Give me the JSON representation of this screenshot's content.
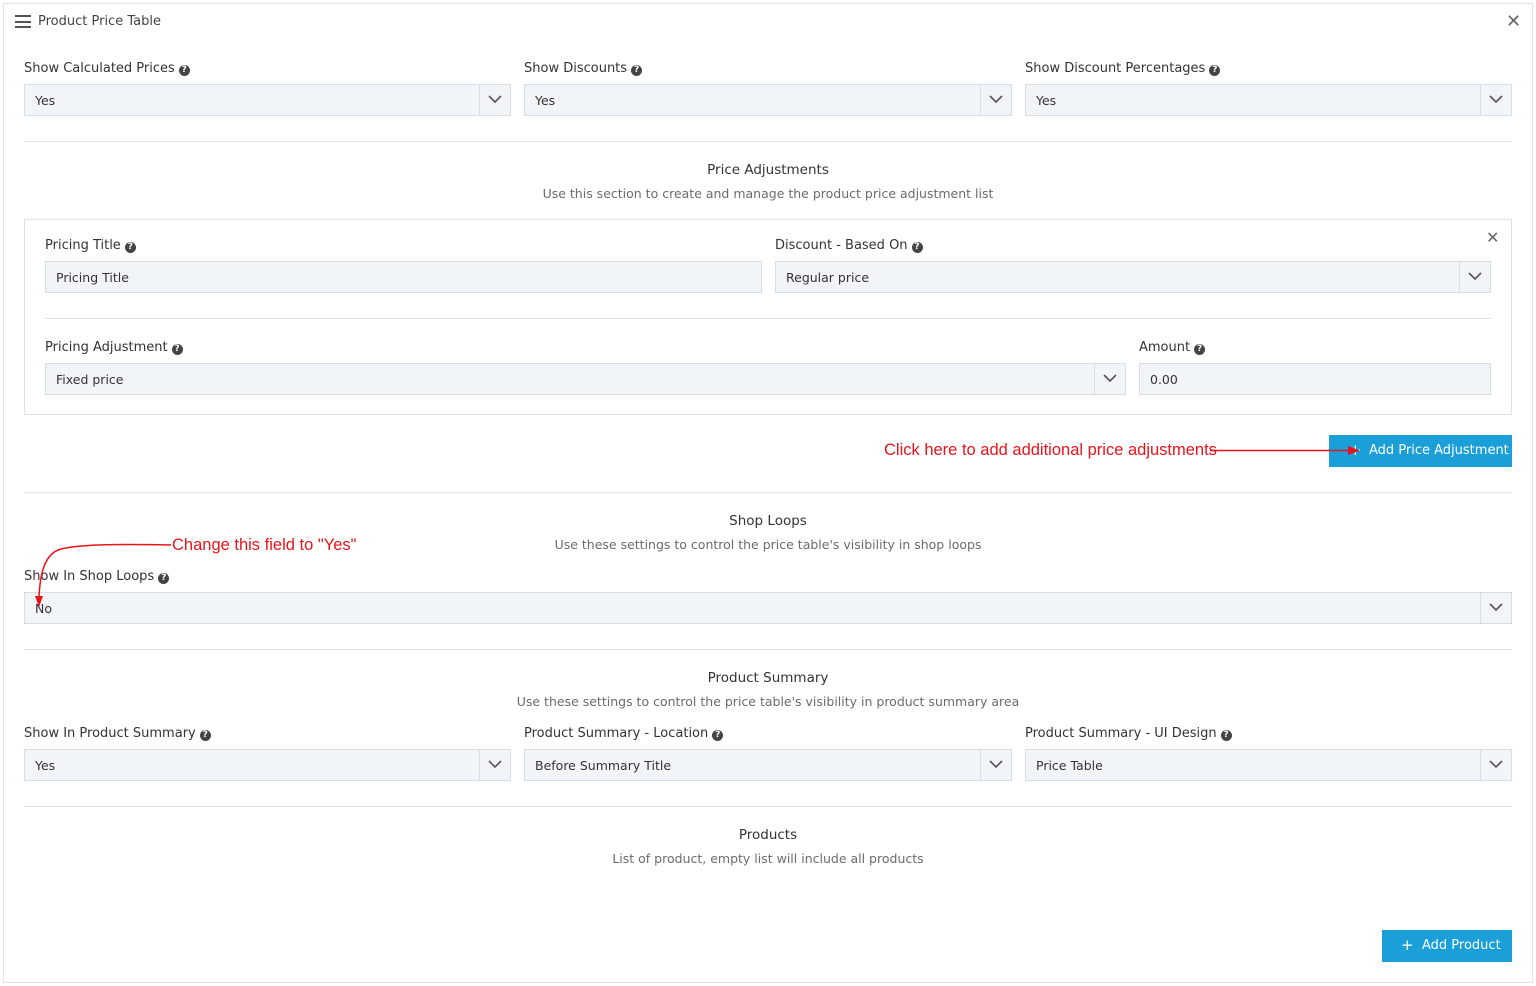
{
  "header": {
    "title": "Product Price Table"
  },
  "display_settings": {
    "show_calculated_prices": {
      "label": "Show Calculated Prices",
      "value": "Yes"
    },
    "show_discounts": {
      "label": "Show Discounts",
      "value": "Yes"
    },
    "show_discount_percentages": {
      "label": "Show Discount Percentages",
      "value": "Yes"
    }
  },
  "price_adjustments": {
    "title": "Price Adjustments",
    "description": "Use this section to create and manage the product price adjustment list",
    "item": {
      "pricing_title": {
        "label": "Pricing Title",
        "placeholder": "Pricing Title"
      },
      "discount_based_on": {
        "label": "Discount - Based On",
        "value": "Regular price"
      },
      "pricing_adjustment": {
        "label": "Pricing Adjustment",
        "value": "Fixed price"
      },
      "amount": {
        "label": "Amount",
        "value": "0.00"
      }
    },
    "add_button": "Add Price Adjustment",
    "annotation": "Click here to add additional price adjustments"
  },
  "shop_loops": {
    "title": "Shop Loops",
    "description": "Use these settings to control the price table's visibility in shop loops",
    "show_in_shop_loops": {
      "label": "Show In Shop Loops",
      "value": "No"
    },
    "annotation": "Change this field to \"Yes\""
  },
  "product_summary": {
    "title": "Product Summary",
    "description": "Use these settings to control the price table's visibility in product summary area",
    "show_in_product_summary": {
      "label": "Show In Product Summary",
      "value": "Yes"
    },
    "location": {
      "label": "Product Summary - Location",
      "value": "Before Summary Title"
    },
    "ui_design": {
      "label": "Product Summary - UI Design",
      "value": "Price Table"
    }
  },
  "products": {
    "title": "Products",
    "description": "List of product, empty list will include all products",
    "add_button": "Add Product"
  },
  "icons": {
    "help": "?",
    "close": "✕",
    "plus": "+"
  },
  "colors": {
    "accent": "#1a9fd9",
    "annotation": "#e8141c",
    "field_bg": "#f2f5f7"
  }
}
